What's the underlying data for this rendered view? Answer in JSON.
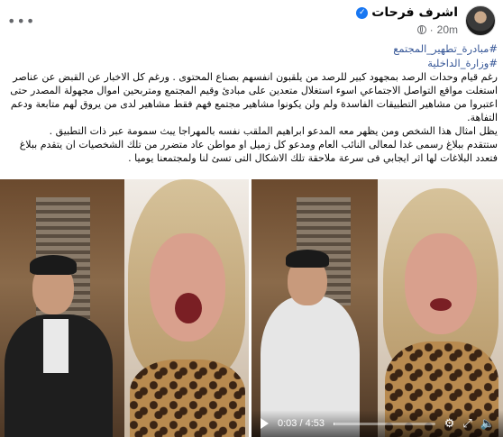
{
  "post": {
    "author": "اشرف فرحات",
    "time": "20m",
    "hashtags": [
      "#مبادرة_تطهير_المجتمع",
      "#وزارة_الداخلية"
    ],
    "paragraphs": [
      "رغم قيام وحدات الرصد بمجهود كبير للرصد من يلقبون انفسهم بصناع المحتوى . ورغم كل الاخبار عن القبض عن عناصر استغلت مواقع التواصل الاجتماعي اسوء استغلال متعدين على مبادئ وقيم المجتمع ومتربحين اموال مجهولة المصدر حتى اعتبروا من مشاهير التطبيقات الفاسدة ولم ولن يكونوا مشاهير مجتمع فهم فقط مشاهير لدى من يروق لهم متابعة ودعم التفاهة.",
      "يظل امثال هذا الشخص ومن يظهر معه المدعو ابراهيم الملقب نفسه بالمهراجا يبث سمومة عبر ذات التطبيق .",
      "ستتقدم ببلاغ رسمى غدا لمعالى النائب العام ومدعو كل زميل او مواطن عاد متضرر من تلك الشخصيات ان يتقدم ببلاغ فتعدد البلاغات لها اثر ايجابي فى سرعة ملاحقة تلك الاشكال التى تسئ لنا ولمجتمعنا يوميا ."
    ]
  },
  "video": {
    "current_time": "0:03",
    "separator": " / ",
    "duration": "4:53",
    "progress_fraction": 0.01,
    "icons": [
      "play-icon",
      "settings-gear-icon",
      "fullscreen-icon",
      "volume-icon"
    ]
  },
  "colors": {
    "hashtag": "#385898",
    "verified": "#1877f2",
    "meta": "#65676b"
  }
}
